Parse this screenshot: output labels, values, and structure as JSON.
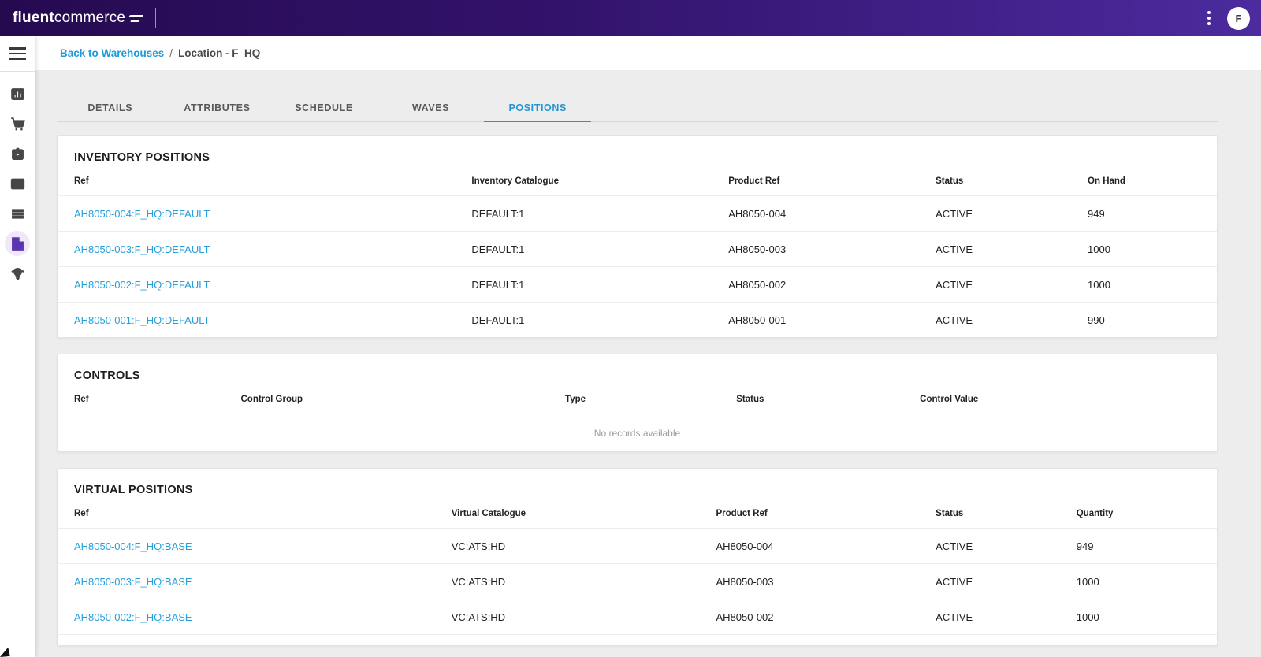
{
  "appbar": {
    "brand_bold": "fluent",
    "brand_light": "commerce",
    "avatar_initial": "F"
  },
  "breadcrumb": {
    "link": "Back to Warehouses",
    "separator": "/",
    "current": "Location - F_HQ"
  },
  "sidebar": {
    "items": [
      {
        "name": "analytics"
      },
      {
        "name": "orders"
      },
      {
        "name": "fulfilment"
      },
      {
        "name": "payments"
      },
      {
        "name": "inventory"
      },
      {
        "name": "locations",
        "active": true
      },
      {
        "name": "insights"
      }
    ]
  },
  "tabs": {
    "items": [
      "DETAILS",
      "ATTRIBUTES",
      "SCHEDULE",
      "WAVES",
      "POSITIONS"
    ],
    "active": "POSITIONS"
  },
  "colors": {
    "header_gradient_start": "#250a50",
    "header_gradient_end": "#4c2b9e",
    "accent_blue": "#2196d3",
    "link_blue": "#279fd9",
    "active_sidebar_purple": "#5b35af",
    "page_background": "#ededee"
  },
  "inventory_positions": {
    "title": "INVENTORY POSITIONS",
    "columns": {
      "c1": "Ref",
      "c2": "Inventory Catalogue",
      "c3": "Product Ref",
      "c4": "Status",
      "c5": "On Hand"
    },
    "rows": [
      {
        "ref": "AH8050-004:F_HQ:DEFAULT",
        "catalogue": "DEFAULT:1",
        "product_ref": "AH8050-004",
        "status": "ACTIVE",
        "on_hand": "949"
      },
      {
        "ref": "AH8050-003:F_HQ:DEFAULT",
        "catalogue": "DEFAULT:1",
        "product_ref": "AH8050-003",
        "status": "ACTIVE",
        "on_hand": "1000"
      },
      {
        "ref": "AH8050-002:F_HQ:DEFAULT",
        "catalogue": "DEFAULT:1",
        "product_ref": "AH8050-002",
        "status": "ACTIVE",
        "on_hand": "1000"
      },
      {
        "ref": "AH8050-001:F_HQ:DEFAULT",
        "catalogue": "DEFAULT:1",
        "product_ref": "AH8050-001",
        "status": "ACTIVE",
        "on_hand": "990"
      }
    ]
  },
  "controls": {
    "title": "CONTROLS",
    "columns": {
      "c1": "Ref",
      "c2": "Control Group",
      "c3": "Type",
      "c4": "Status",
      "c5": "Control Value"
    },
    "empty_message": "No records available"
  },
  "virtual_positions": {
    "title": "VIRTUAL POSITIONS",
    "columns": {
      "c1": "Ref",
      "c2": "Virtual Catalogue",
      "c3": "Product Ref",
      "c4": "Status",
      "c5": "Quantity"
    },
    "rows": [
      {
        "ref": "AH8050-004:F_HQ:BASE",
        "catalogue": "VC:ATS:HD",
        "product_ref": "AH8050-004",
        "status": "ACTIVE",
        "qty": "949"
      },
      {
        "ref": "AH8050-003:F_HQ:BASE",
        "catalogue": "VC:ATS:HD",
        "product_ref": "AH8050-003",
        "status": "ACTIVE",
        "qty": "1000"
      },
      {
        "ref": "AH8050-002:F_HQ:BASE",
        "catalogue": "VC:ATS:HD",
        "product_ref": "AH8050-002",
        "status": "ACTIVE",
        "qty": "1000"
      }
    ]
  }
}
